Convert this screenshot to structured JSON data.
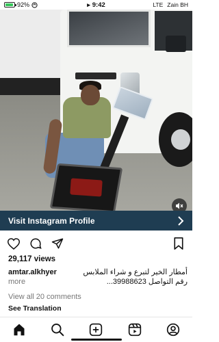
{
  "status_bar": {
    "battery": "92%",
    "time": "9:42",
    "network": "LTE",
    "carrier": "Zain BH",
    "battery_color": "#34c759"
  },
  "media": {
    "mute_icon": "speaker-muted-icon"
  },
  "cta": {
    "label": "Visit Instagram Profile",
    "background": "#1f3d52"
  },
  "post": {
    "views": "29,117 views",
    "username": "amtar.alkhyer",
    "caption_line1": "أمطار الخير لتبرع و شراء الملابس",
    "more_label": "more",
    "caption_line2": "رقم التواصل 39988623...",
    "view_comments": "View all 20 comments",
    "see_translation": "See Translation"
  },
  "tabbar": {
    "items": [
      "home-icon",
      "search-icon",
      "create-icon",
      "reels-icon",
      "profile-icon"
    ]
  }
}
